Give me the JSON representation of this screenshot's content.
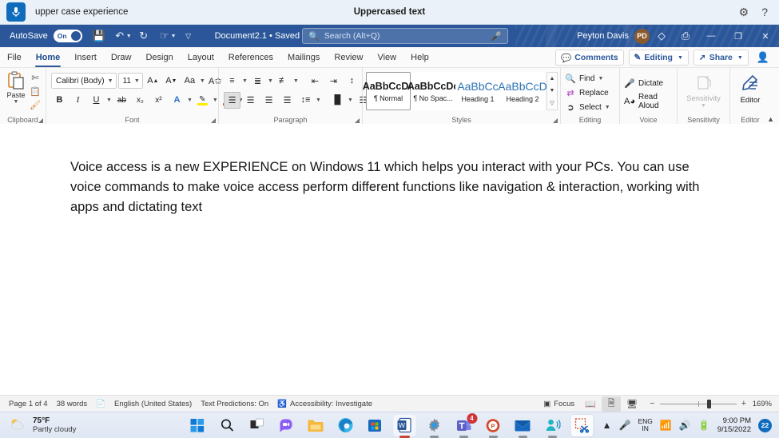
{
  "voice_access": {
    "mic_icon": "microphone-icon",
    "command_text": "upper case experience",
    "status_text": "Uppercased text",
    "settings_icon": "gear-icon",
    "help_icon": "help-icon"
  },
  "title_bar": {
    "autosave_label": "AutoSave",
    "autosave_state": "On",
    "save_icon": "save-icon",
    "undo_icon": "undo-icon",
    "redo_icon": "redo-icon",
    "touch_icon": "touch-mode-icon",
    "customize_icon": "customize-quick-access-icon",
    "document_name": "Document2.1 • Saved",
    "search": {
      "placeholder": "Search (Alt+Q)",
      "value": "",
      "icon": "search-icon",
      "mic_icon": "microphone-icon"
    },
    "user_name": "Peyton Davis",
    "avatar_initials": "PD",
    "diamond_icon": "diamond-icon",
    "ribbon_display_icon": "ribbon-display-options-icon",
    "minimize": "—",
    "restore": "❐",
    "close": "✕"
  },
  "ribbon_tabs": {
    "items": [
      {
        "label": "File",
        "active": false
      },
      {
        "label": "Home",
        "active": true
      },
      {
        "label": "Insert",
        "active": false
      },
      {
        "label": "Draw",
        "active": false
      },
      {
        "label": "Design",
        "active": false
      },
      {
        "label": "Layout",
        "active": false
      },
      {
        "label": "References",
        "active": false
      },
      {
        "label": "Mailings",
        "active": false
      },
      {
        "label": "Review",
        "active": false
      },
      {
        "label": "View",
        "active": false
      },
      {
        "label": "Help",
        "active": false
      }
    ],
    "comments_label": "Comments",
    "editing_label": "Editing",
    "share_label": "Share",
    "catchup_icon": "catch-up-icon"
  },
  "ribbon": {
    "clipboard": {
      "group_label": "Clipboard",
      "paste_label": "Paste",
      "cut_icon": "scissors-icon",
      "copy_icon": "copy-icon",
      "format_painter_icon": "format-painter-icon"
    },
    "font": {
      "group_label": "Font",
      "font_name": "Calibri (Body)",
      "font_size": "11",
      "grow_font": "A",
      "shrink_font": "A",
      "change_case": "Aa",
      "clear_formatting_icon": "clear-formatting-icon",
      "bold": "B",
      "italic": "I",
      "underline": "U",
      "strikethrough": "ab",
      "subscript": "x₂",
      "superscript": "x²",
      "text_effects": "A",
      "highlight": "A",
      "font_color": "A",
      "highlight_color": "#ffeb00",
      "font_color_value": "#d83b01"
    },
    "paragraph": {
      "group_label": "Paragraph",
      "bullets_icon": "bullet-list-icon",
      "numbering_icon": "numbered-list-icon",
      "multilevel_icon": "multilevel-list-icon",
      "decrease_indent_icon": "decrease-indent-icon",
      "increase_indent_icon": "increase-indent-icon",
      "sort_icon": "sort-icon",
      "show_marks_icon": "paragraph-marks-icon",
      "align_left_icon": "align-left-icon",
      "align_center_icon": "align-center-icon",
      "align_right_icon": "align-right-icon",
      "justify_icon": "justify-icon",
      "line_spacing_icon": "line-spacing-icon",
      "shading_icon": "shading-icon",
      "borders_icon": "borders-icon"
    },
    "styles": {
      "group_label": "Styles",
      "items": [
        {
          "preview": "AaBbCcDc",
          "name": "¶ Normal",
          "selected": true,
          "heading": false
        },
        {
          "preview": "AaBbCcDc",
          "name": "¶ No Spac...",
          "selected": false,
          "heading": false
        },
        {
          "preview": "AaBbCc",
          "name": "Heading 1",
          "selected": false,
          "heading": true
        },
        {
          "preview": "AaBbCcD",
          "name": "Heading 2",
          "selected": false,
          "heading": true
        }
      ]
    },
    "editing": {
      "group_label": "Editing",
      "find_label": "Find",
      "replace_label": "Replace",
      "select_label": "Select"
    },
    "voice": {
      "group_label": "Voice",
      "dictate_label": "Dictate",
      "read_aloud_label": "Read Aloud"
    },
    "sensitivity": {
      "group_label": "Sensitivity",
      "button_label": "Sensitivity"
    },
    "editor": {
      "group_label": "Editor",
      "button_label": "Editor"
    },
    "collapse_icon": "collapse-ribbon-icon"
  },
  "document": {
    "body_text": "Voice access is a new EXPERIENCE on Windows 11 which helps you interact with your PCs. You can use voice commands to make voice access perform different functions like navigation & interaction, working with apps and dictating text"
  },
  "status_bar": {
    "page": "Page 1 of 4",
    "words": "38 words",
    "proofing_icon": "proofing-icon",
    "language": "English (United States)",
    "text_predictions": "Text Predictions: On",
    "accessibility": "Accessibility: Investigate",
    "focus_label": "Focus",
    "read_mode_icon": "read-mode-icon",
    "print_layout_icon": "print-layout-icon",
    "web_layout_icon": "web-layout-icon",
    "zoom_out": "−",
    "zoom_in": "+",
    "zoom_level": "169%"
  },
  "taskbar": {
    "weather_temp": "75°F",
    "weather_condition": "Partly cloudy",
    "weather_icon": "partly-cloudy-icon",
    "apps": [
      {
        "name": "start-button",
        "icon": "windows-logo-icon"
      },
      {
        "name": "search-button",
        "icon": "search-icon"
      },
      {
        "name": "task-view-button",
        "icon": "task-view-icon"
      },
      {
        "name": "chat-button",
        "icon": "chat-icon"
      },
      {
        "name": "file-explorer-button",
        "icon": "folder-icon"
      },
      {
        "name": "edge-button",
        "icon": "edge-icon"
      },
      {
        "name": "microsoft-store-button",
        "icon": "store-icon"
      },
      {
        "name": "word-button",
        "icon": "word-icon"
      },
      {
        "name": "settings-button",
        "icon": "gear-icon"
      },
      {
        "name": "teams-button",
        "icon": "teams-icon",
        "badge": "4"
      },
      {
        "name": "powerpoint-button",
        "icon": "powerpoint-icon"
      },
      {
        "name": "mail-button",
        "icon": "mail-icon"
      },
      {
        "name": "voice-access-button",
        "icon": "voice-access-icon"
      },
      {
        "name": "snipping-tool-button",
        "icon": "snipping-tool-icon"
      }
    ],
    "tray": {
      "chevron_icon": "chevron-up-icon",
      "mic_icon": "microphone-icon",
      "language_line1": "ENG",
      "language_line2": "IN",
      "wifi_icon": "wifi-icon",
      "volume_icon": "volume-icon",
      "battery_icon": "battery-icon",
      "time": "9:00 PM",
      "date": "9/15/2022",
      "notification_count": "22"
    }
  }
}
